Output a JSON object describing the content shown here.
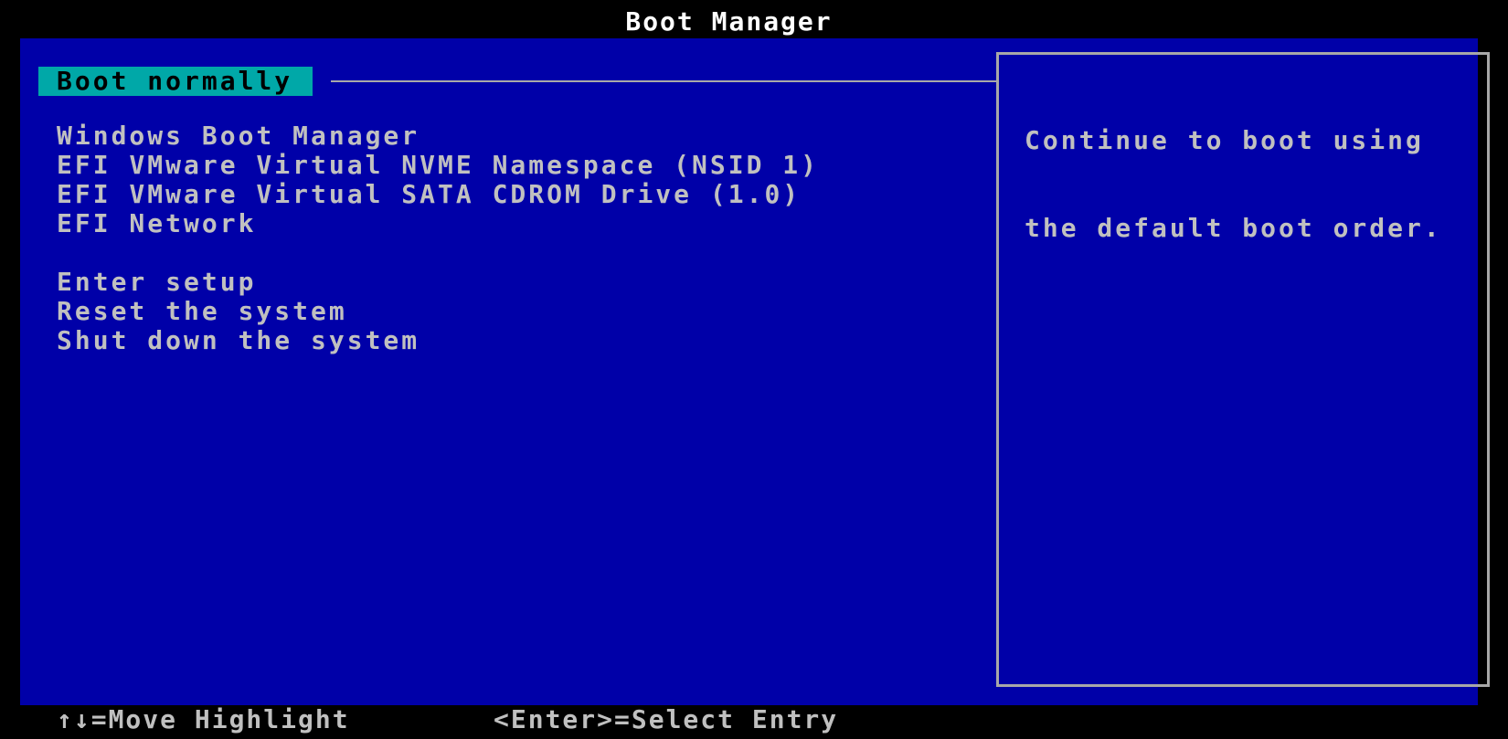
{
  "header": {
    "title": "Boot Manager"
  },
  "menu": {
    "selected_label": "Boot normally",
    "boot_entries": [
      "Windows Boot Manager",
      "EFI VMware Virtual NVME Namespace (NSID 1)",
      "EFI VMware Virtual SATA CDROM Drive (1.0)",
      "EFI Network"
    ],
    "system_entries": [
      "Enter setup",
      "Reset the system",
      "Shut down the system"
    ]
  },
  "help": {
    "lines": [
      "Continue to boot using",
      "the default boot order."
    ]
  },
  "footer": {
    "move_hint": "↑↓=Move Highlight",
    "select_hint": "<Enter>=Select Entry"
  },
  "colors": {
    "background": "#000000",
    "panel": "#0000a8",
    "highlight": "#00a8a8",
    "text": "#c0c0c0",
    "title": "#ffffff"
  }
}
